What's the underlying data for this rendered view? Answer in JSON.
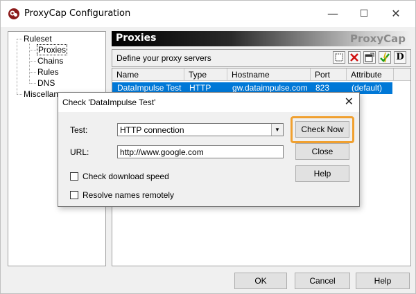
{
  "window": {
    "title": "ProxyCap Configuration",
    "minimize": "—",
    "maximize": "☐",
    "close": "✕"
  },
  "tree": {
    "items": [
      {
        "label": "Ruleset"
      },
      {
        "label": "Proxies"
      },
      {
        "label": "Chains"
      },
      {
        "label": "Rules"
      },
      {
        "label": "DNS"
      },
      {
        "label": "Miscellaneous"
      }
    ]
  },
  "pane": {
    "title": "Proxies",
    "brand": "ProxyCap",
    "toolbar_label": "Define your proxy servers",
    "columns": [
      "Name",
      "Type",
      "Hostname",
      "Port",
      "Attribute"
    ],
    "rows": [
      {
        "name": "DataImpulse Test",
        "type": "HTTP",
        "hostname": "gw.dataimpulse.com",
        "port": "823",
        "attribute": "(default)"
      }
    ]
  },
  "footer": {
    "ok": "OK",
    "cancel": "Cancel",
    "help": "Help"
  },
  "dialog": {
    "title": "Check 'DataImpulse Test'",
    "close": "✕",
    "test_label": "Test:",
    "test_value": "HTTP connection",
    "url_label": "URL:",
    "url_value": "http://www.google.com",
    "check_download_speed": "Check download speed",
    "resolve_remotely": "Resolve names remotely",
    "check_now": "Check Now",
    "close_btn": "Close",
    "help_btn": "Help"
  },
  "colors": {
    "selection": "#0078d7",
    "highlight": "#f0a030"
  }
}
